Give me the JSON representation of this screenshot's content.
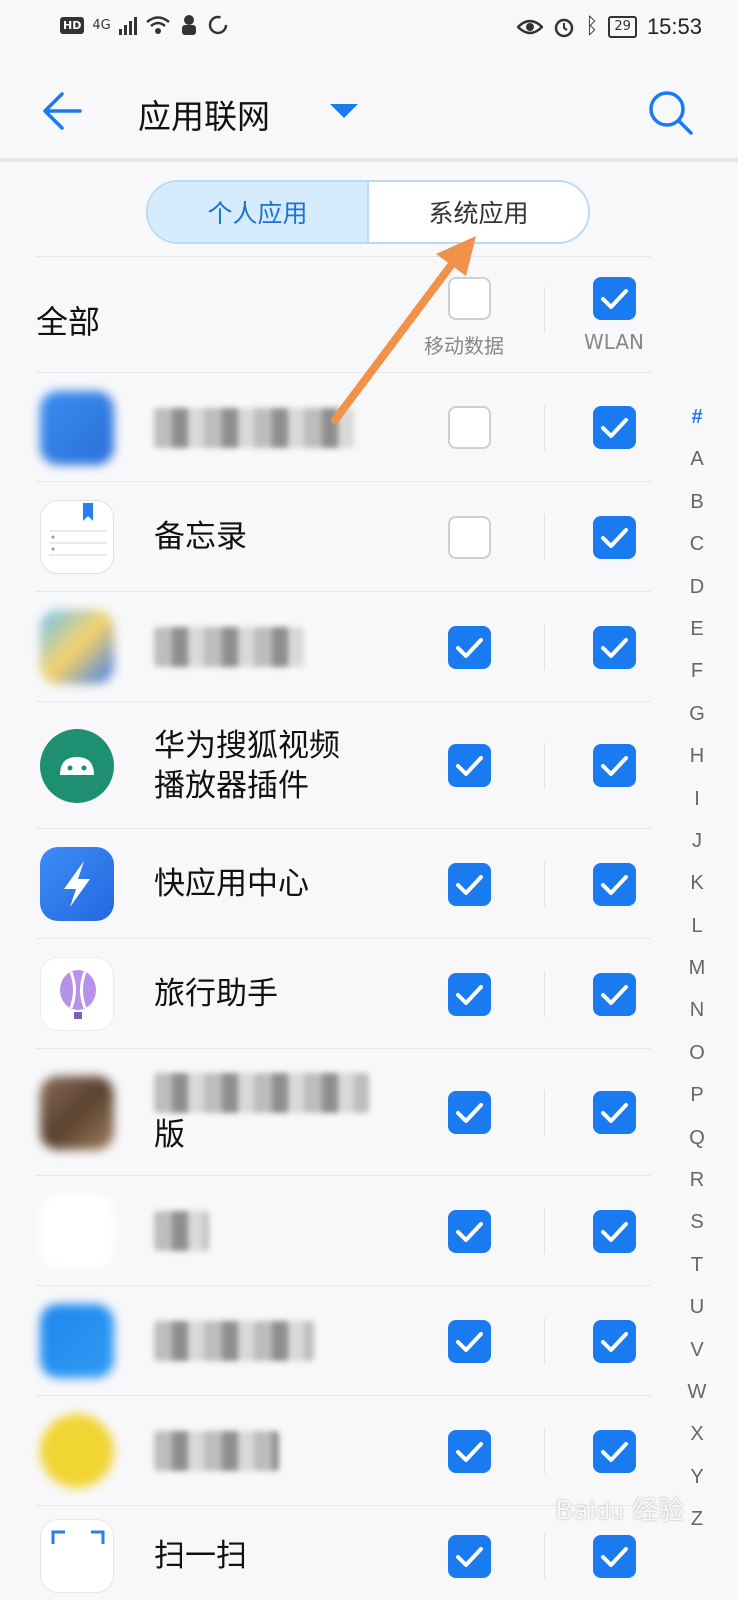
{
  "status_bar": {
    "hd": "HD",
    "network": "4G",
    "battery": "29",
    "time": "15:53"
  },
  "app_bar": {
    "title": "应用联网"
  },
  "tabs": {
    "personal": "个人应用",
    "system": "系统应用"
  },
  "header": {
    "all_label": "全部",
    "mobile_data_label": "移动数据",
    "wlan_label": "WLAN",
    "mobile_data_checked": false,
    "wlan_checked": true
  },
  "apps": [
    {
      "name": "",
      "mobile": false,
      "wlan": true,
      "icon": "download-app-icon",
      "redacted": true
    },
    {
      "name": "备忘录",
      "mobile": false,
      "wlan": true,
      "icon": "memo-icon"
    },
    {
      "name": "",
      "mobile": true,
      "wlan": true,
      "icon": "map-app-icon",
      "redacted": true
    },
    {
      "name": "华为搜狐视频播放器插件",
      "name_lines": [
        "华为搜狐视频",
        "播放器插件"
      ],
      "mobile": true,
      "wlan": true,
      "icon": "android-icon"
    },
    {
      "name": "快应用中心",
      "mobile": true,
      "wlan": true,
      "icon": "quick-app-icon"
    },
    {
      "name": "旅行助手",
      "mobile": true,
      "wlan": true,
      "icon": "balloon-icon"
    },
    {
      "name": "版",
      "mobile": true,
      "wlan": true,
      "icon": "game-app-icon",
      "redacted": true
    },
    {
      "name": "",
      "mobile": true,
      "wlan": true,
      "icon": "qq-icon",
      "redacted": true
    },
    {
      "name": "",
      "mobile": true,
      "wlan": true,
      "icon": "browser-app-icon",
      "redacted": true
    },
    {
      "name": "",
      "mobile": true,
      "wlan": true,
      "icon": "music-app-icon",
      "redacted": true
    },
    {
      "name": "扫一扫",
      "mobile": true,
      "wlan": true,
      "icon": "scan-icon"
    }
  ],
  "alphabet": [
    "#",
    "A",
    "B",
    "C",
    "D",
    "E",
    "F",
    "G",
    "H",
    "I",
    "J",
    "K",
    "L",
    "M",
    "N",
    "O",
    "P",
    "Q",
    "R",
    "S",
    "T",
    "U",
    "V",
    "W",
    "X",
    "Y",
    "Z"
  ],
  "colors": {
    "accent": "#1a7af0",
    "annotation_arrow": "#f0924a"
  }
}
